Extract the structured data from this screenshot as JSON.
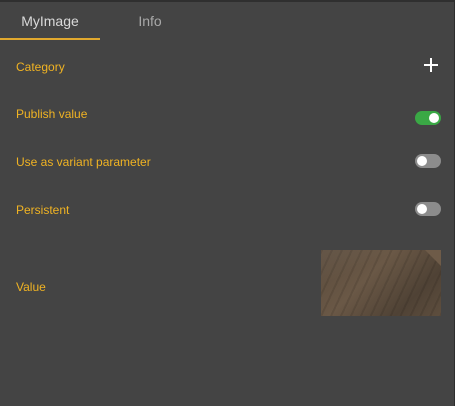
{
  "tabs": [
    {
      "label": "MyImage"
    },
    {
      "label": "Info"
    }
  ],
  "properties": {
    "category": {
      "label": "Category",
      "action_icon": "plus-icon"
    },
    "publish_value": {
      "label": "Publish value",
      "enabled": true
    },
    "use_as_variant_parameter": {
      "label": "Use as variant parameter",
      "enabled": false
    },
    "persistent": {
      "label": "Persistent",
      "enabled": false
    },
    "value": {
      "label": "Value",
      "preview": "wood-texture-thumbnail"
    }
  },
  "colors": {
    "panel_background": "#444444",
    "label": "#f0b323",
    "active_tab_underline": "#e0a82e",
    "toggle_on": "#3aa845",
    "toggle_off": "#8c8c8c"
  }
}
